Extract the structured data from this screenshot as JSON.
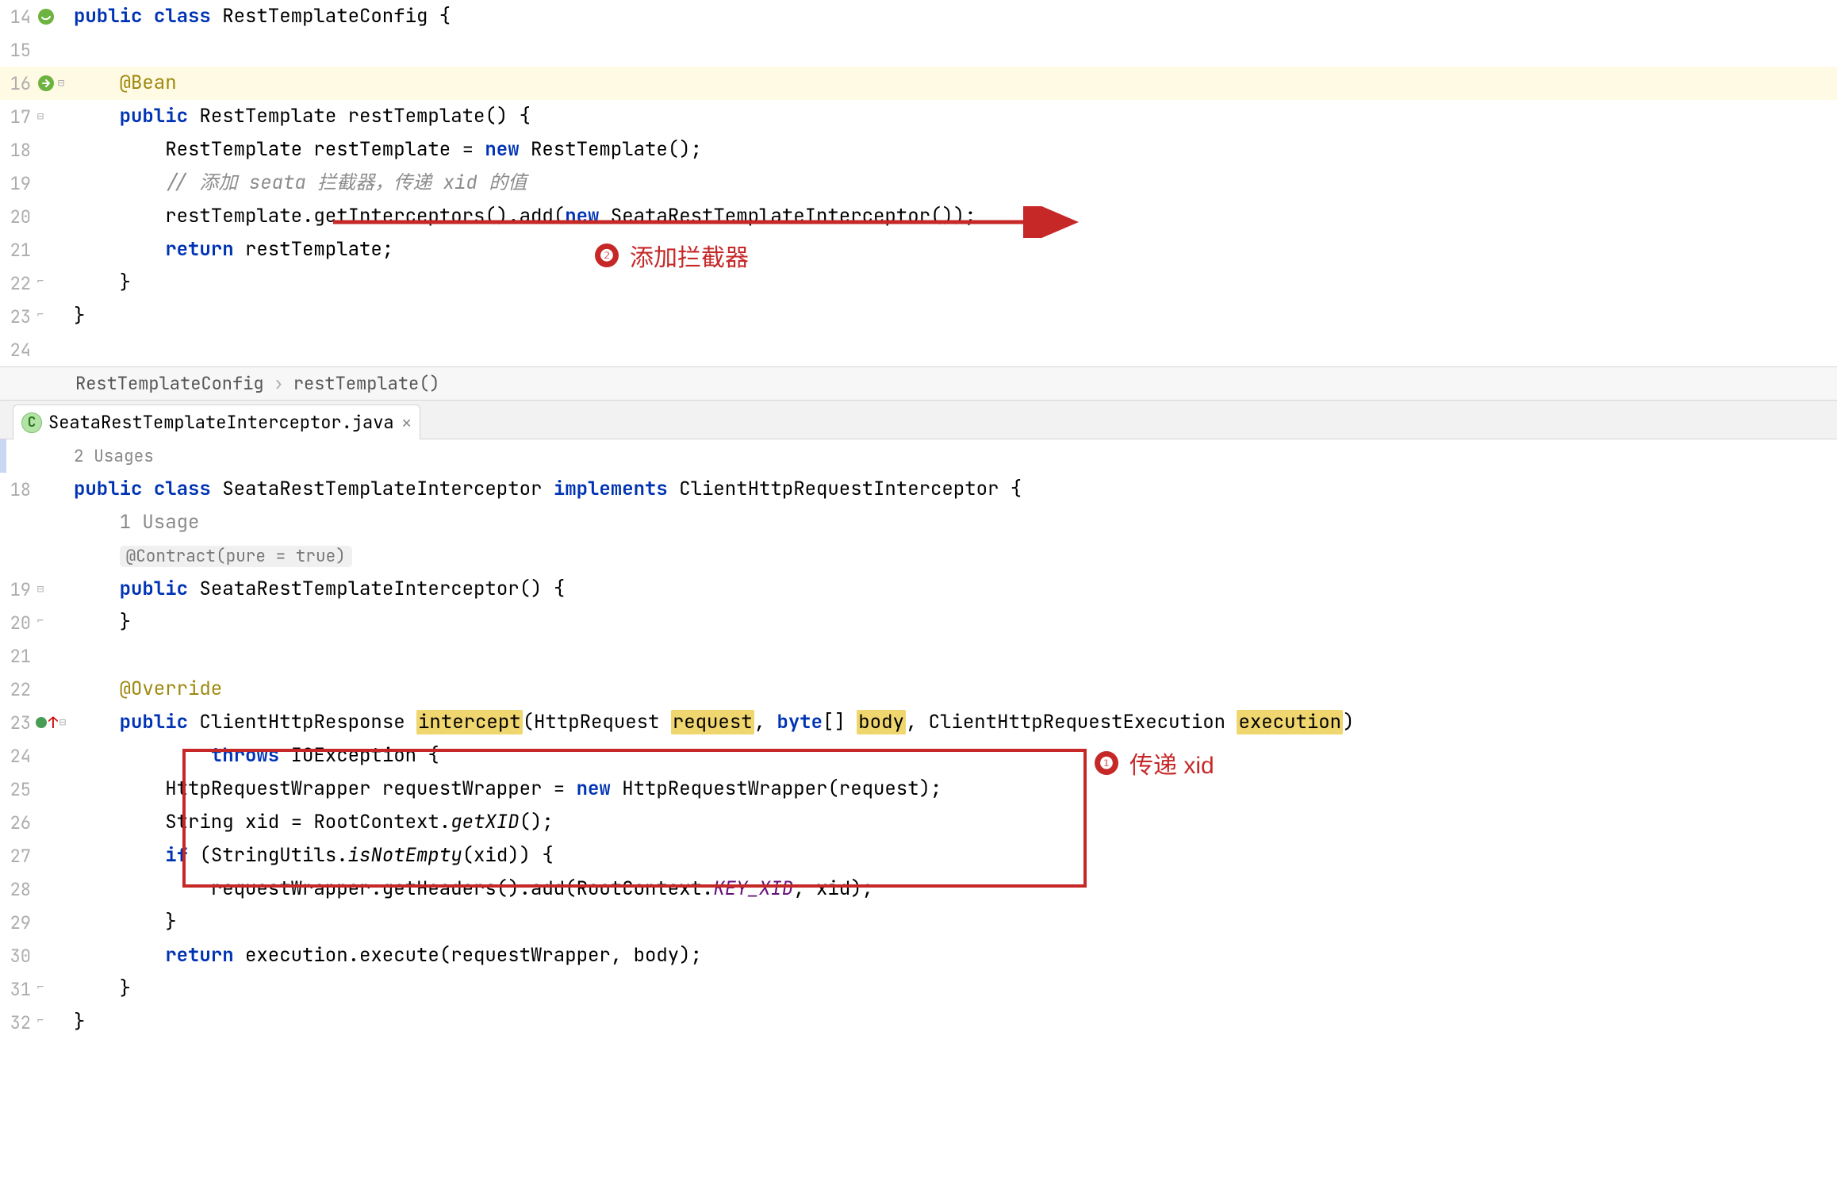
{
  "pane1": {
    "lines": [
      {
        "n": 14,
        "icon": "bean-green",
        "html": "<span class='kw'>public</span> <span class='kw'>class</span> RestTemplateConfig {"
      },
      {
        "n": 15,
        "html": ""
      },
      {
        "n": 16,
        "icon": "bean-return",
        "hl": true,
        "fold": "-",
        "html": "    <span class='ann'>@Bean</span>"
      },
      {
        "n": 17,
        "fold": "-",
        "html": "    <span class='kw'>public</span> RestTemplate restTemplate() {"
      },
      {
        "n": 18,
        "html": "        RestTemplate restTemplate = <span class='kw'>new</span> RestTemplate();"
      },
      {
        "n": 19,
        "html": "        <span class='cmt'>// 添加 </span><span class='cmt-i'>seata</span><span class='cmt'> 拦截器，传递 </span><span class='cmt-i'>xid</span><span class='cmt'> 的值</span>"
      },
      {
        "n": 20,
        "html": "        restTemplate.getInterceptors().add(<span class='kw'>new</span> SeataRestTemplateInterceptor());"
      },
      {
        "n": 21,
        "html": "        <span class='kw'>return</span> restTemplate;"
      },
      {
        "n": 22,
        "fold": "up",
        "html": "    }"
      },
      {
        "n": 23,
        "fold": "up",
        "html": "}"
      },
      {
        "n": 24,
        "html": ""
      }
    ],
    "anno2_badge": "❷",
    "anno2_text": "添加拦截器"
  },
  "breadcrumb": {
    "item1": "RestTemplateConfig",
    "item2": "restTemplate()"
  },
  "tab": {
    "label": "SeataRestTemplateInterceptor.java"
  },
  "pane2": {
    "usages_top": "2 Usages",
    "usages_inner": "1 Usage",
    "contract_inlay": "@Contract(pure = true)",
    "small_left_num": "19",
    "lines": [
      {
        "n": 18,
        "html": "<span class='kw'>public</span> <span class='kw'>class</span> SeataRestTemplateInterceptor <span class='kw'>implements</span> ClientHttpRequestInterceptor {"
      },
      {
        "n": 19,
        "fold": "-",
        "html": "    <span class='kw'>public</span> SeataRestTemplateInterceptor() {"
      },
      {
        "n": 20,
        "fold": "up",
        "html": "    }"
      },
      {
        "n": 21,
        "html": ""
      },
      {
        "n": 22,
        "html": "    <span class='ann'>@Override</span>"
      },
      {
        "n": 23,
        "icon": "impl-up",
        "fold": "-",
        "html": "    <span class='kw'>public</span> ClientHttpResponse <span class='param-hl'>intercept</span>(HttpRequest <span class='param-hl'>request</span>, <span class='kw'>byte</span>[] <span class='param-hl'>body</span>, ClientHttpRequestExecution <span class='param-hl'>execution</span>)"
      },
      {
        "n": 24,
        "html": "            <span class='kw'>throws</span> IOException {"
      },
      {
        "n": 25,
        "html": "        HttpRequestWrapper requestWrapper = <span class='kw'>new</span> HttpRequestWrapper(request);"
      },
      {
        "n": 26,
        "html": "        String xid = RootContext.<span class='mth-static-italic'>getXID</span>();"
      },
      {
        "n": 27,
        "html": "        <span class='kw'>if</span> (StringUtils.<span class='mth-static-italic'>isNotEmpty</span>(xid)) {"
      },
      {
        "n": 28,
        "html": "            requestWrapper.getHeaders().add(RootContext.<span class='field mth-static-italic'>KEY_XID</span>, xid);"
      },
      {
        "n": 29,
        "html": "        }"
      },
      {
        "n": 30,
        "html": "        <span class='kw'>return</span> execution.execute(requestWrapper, body);"
      },
      {
        "n": 31,
        "fold": "up",
        "html": "    }"
      },
      {
        "n": 32,
        "fold": "up",
        "html": "}"
      }
    ],
    "anno1_badge": "❶",
    "anno1_text": "传递 xid"
  }
}
